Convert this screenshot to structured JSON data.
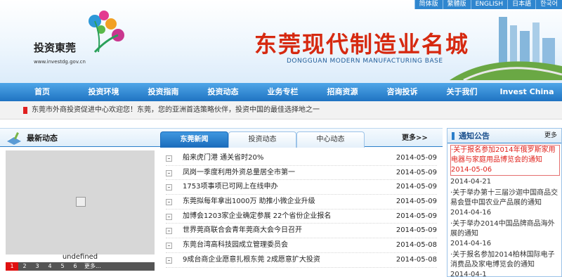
{
  "languages": [
    "简体版",
    "繁體版",
    "ENGLISH",
    "日本語",
    "한국어"
  ],
  "logo": {
    "name": "投资東莞",
    "url": "www.investdg.gov.cn"
  },
  "banner": {
    "slogan": "东莞现代制造业名城",
    "slogan_en": "DONGGUAN MODERN MANUFACTURING BASE"
  },
  "nav": [
    "首页",
    "投资环境",
    "投资指南",
    "投资动态",
    "业务专栏",
    "招商资源",
    "咨询投诉",
    "关于我们",
    "Invest China"
  ],
  "ticker": "东莞市外商投资促进中心欢迎您！东莞，您的亚洲首选策略伙伴，投资中国的最佳选择地之一",
  "news": {
    "section_title": "最新动态",
    "tabs": [
      "东莞新闻",
      "投资动态",
      "中心动态"
    ],
    "active_tab": 0,
    "more": "更多>>",
    "photo_caption": "undefined",
    "pager": [
      "1",
      "2",
      "3",
      "4",
      "5",
      "6",
      "更多..."
    ],
    "items": [
      {
        "title": "船来虎门港 通关省时20%",
        "date": "2014-05-09"
      },
      {
        "title": "凤岗一季度利用外资总量居全市第一",
        "date": "2014-05-09"
      },
      {
        "title": "1753项事项已可网上在线申办",
        "date": "2014-05-09"
      },
      {
        "title": "东莞拟每年拿出1000万 助推小微企业升级",
        "date": "2014-05-09"
      },
      {
        "title": "加博会1203家企业确定参展 22个省份企业报名",
        "date": "2014-05-09"
      },
      {
        "title": "世界莞商联合会青年莞商大会今日召开",
        "date": "2014-05-09"
      },
      {
        "title": "东莞台湾高科技园成立管理委员会",
        "date": "2014-05-08"
      },
      {
        "title": "9成台商企业愿意扎根东莞 2成愿意扩大投资",
        "date": "2014-05-08"
      }
    ]
  },
  "notice": {
    "title": "通知公告",
    "more": "更多",
    "items": [
      {
        "text": "·关于报名参加2014年俄罗斯家用电器与家庭用品博览会的通知",
        "date": "2014-05-06",
        "highlight": true
      },
      {
        "text": "",
        "date": "2014-04-21",
        "highlight": false
      },
      {
        "text": "·关于举办第十三届沙迦中国商品交易会暨中国农业产品展的通知",
        "date": "2014-04-16",
        "highlight": false
      },
      {
        "text": "·关于举办2014中国品牌商品海外展的通知",
        "date": "2014-04-16",
        "highlight": false
      },
      {
        "text": "·关于报名参加2014柏林国际电子消费品及家电博览会的通知",
        "date": "2014-04-1",
        "highlight": false
      }
    ]
  },
  "colors": {
    "nav": "#2f86cf",
    "accent_red": "#d62910",
    "tab_active": "#1a6bbb"
  }
}
